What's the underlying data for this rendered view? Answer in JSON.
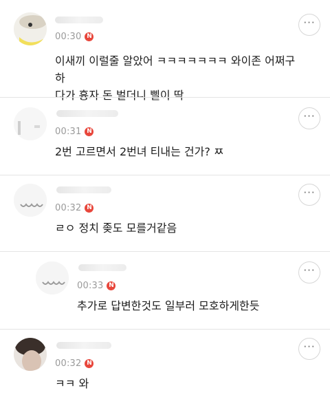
{
  "comments": [
    {
      "time": "00:30",
      "badge": "N",
      "text": "이새끼 이럴줄 알았어 ㅋㅋㅋㅋㅋㅋㅋ 와이존 어쩌구하\n다가 흉자 돈 벌더니 삘이 딱",
      "more_icon": "more-horizontal-icon"
    },
    {
      "time": "00:31",
      "badge": "N",
      "text": "2번 고르면서 2번녀 티내는 건가? ㅉ",
      "more_icon": "more-horizontal-icon"
    },
    {
      "time": "00:32",
      "badge": "N",
      "text": "ㄹㅇ 정치 좆도 모를거같음",
      "more_icon": "more-horizontal-icon"
    },
    {
      "time": "00:33",
      "badge": "N",
      "text": "추가로 답변한것도 일부러 모호하게한듯",
      "more_icon": "more-horizontal-icon"
    },
    {
      "time": "00:32",
      "badge": "N",
      "text": "ㅋㅋ 와",
      "more_icon": "more-horizontal-icon"
    }
  ],
  "more_label": "···",
  "colors": {
    "badge": "#e8473c",
    "time": "#9a9a9a",
    "divider": "#e4e4e4"
  }
}
